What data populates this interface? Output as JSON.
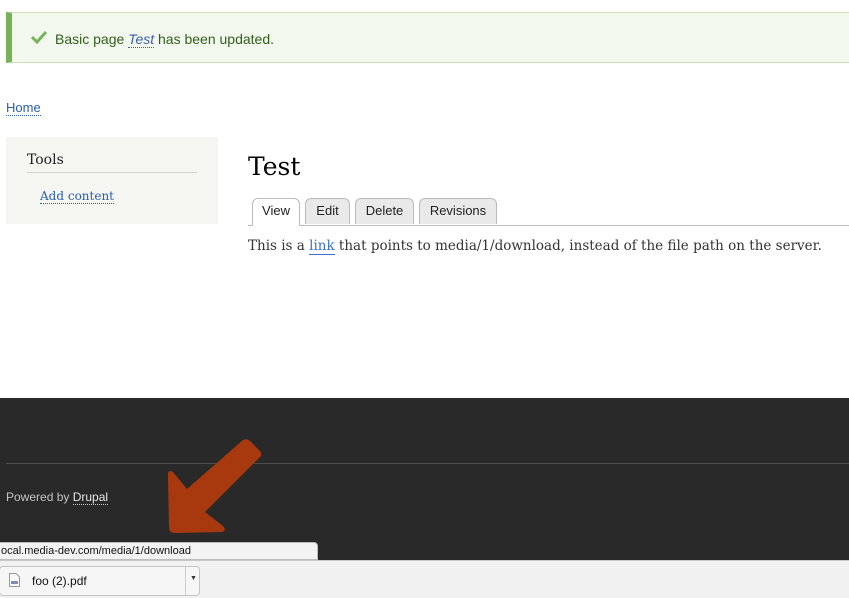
{
  "message": {
    "prefix": "Basic page ",
    "link": "Test",
    "suffix": " has been updated.",
    "icon": "checkmark-icon",
    "status_color": "#77b259"
  },
  "breadcrumb": {
    "home": "Home"
  },
  "sidebar": {
    "title": "Tools",
    "items": [
      {
        "label": "Add content"
      }
    ]
  },
  "page": {
    "title": "Test",
    "tabs": [
      {
        "label": "View",
        "active": true
      },
      {
        "label": "Edit",
        "active": false
      },
      {
        "label": "Delete",
        "active": false
      },
      {
        "label": "Revisions",
        "active": false
      }
    ],
    "body": {
      "prefix": "This is a ",
      "link": "link",
      "suffix": " that points to media/1/download, instead of the file path on the server."
    }
  },
  "footer": {
    "powered_prefix": "Powered by ",
    "powered_link": "Drupal"
  },
  "annotation": {
    "icon": "arrow-icon",
    "color": "#a8390e"
  },
  "status_bar": {
    "url": "ocal.media-dev.com/media/1/download"
  },
  "download_bar": {
    "items": [
      {
        "name": "foo (2).pdf",
        "icon": "pdf-file-icon",
        "menu": "caret-down-icon"
      }
    ]
  }
}
